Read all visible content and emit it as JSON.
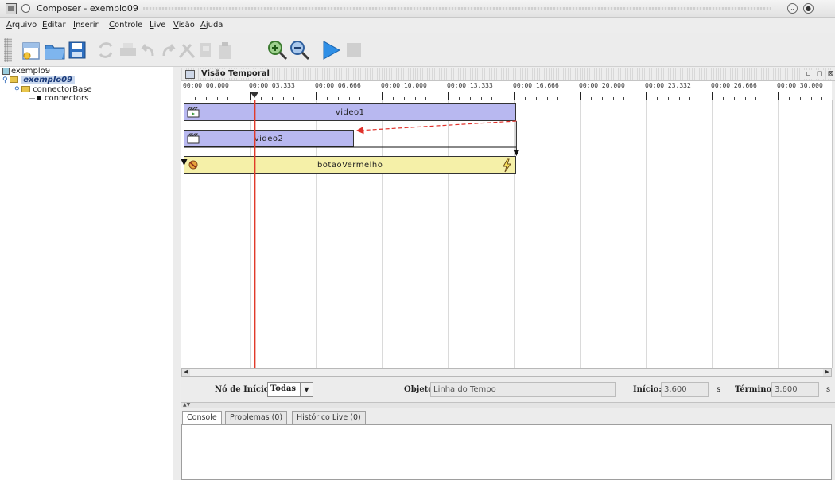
{
  "window": {
    "title": "Composer - exemplo09"
  },
  "menu": [
    "Arquivo",
    "Editar",
    "Inserir",
    "Controle",
    "Live",
    "Visão",
    "Ajuda"
  ],
  "tree": {
    "root": "exemplo9",
    "document": "exemplo09",
    "base": "connectorBase",
    "child": "connectors"
  },
  "timeline": {
    "title": "Visão Temporal",
    "ticks": [
      "00:00:00.000",
      "00:00:03.333",
      "00:00:06.666",
      "00:00:10.000",
      "00:00:13.333",
      "00:00:16.666",
      "00:00:20.000",
      "00:00:23.332",
      "00:00:26.666",
      "00:00:30.000"
    ],
    "tracks": [
      {
        "label": "video1",
        "start": 0,
        "end": 16.8,
        "color": "#b8b8f0",
        "icon": "video-clip-icon"
      },
      {
        "label": "video2",
        "start": 0,
        "end": 8.6,
        "color": "#b8b8f0",
        "icon": "film-clip-icon"
      },
      {
        "label": "botaoVermelho",
        "start": 0,
        "end": 16.8,
        "color": "#f5f0a8",
        "icon": "button-icon"
      }
    ],
    "playhead": 3.6,
    "playhead_color": "#e03a2a",
    "link_color": "#e0302a"
  },
  "props": {
    "start_node_label": "Nó de Início:",
    "start_node_value": "Todas",
    "object_label": "Objeto:",
    "object_value": "Linha do Tempo",
    "begin_label": "Início:",
    "begin_value": "3.600",
    "end_label": "Término:",
    "end_value": "3.600",
    "unit": "s"
  },
  "bottom_tabs": [
    "Console",
    "Problemas (0)",
    "Histórico Live (0)"
  ]
}
